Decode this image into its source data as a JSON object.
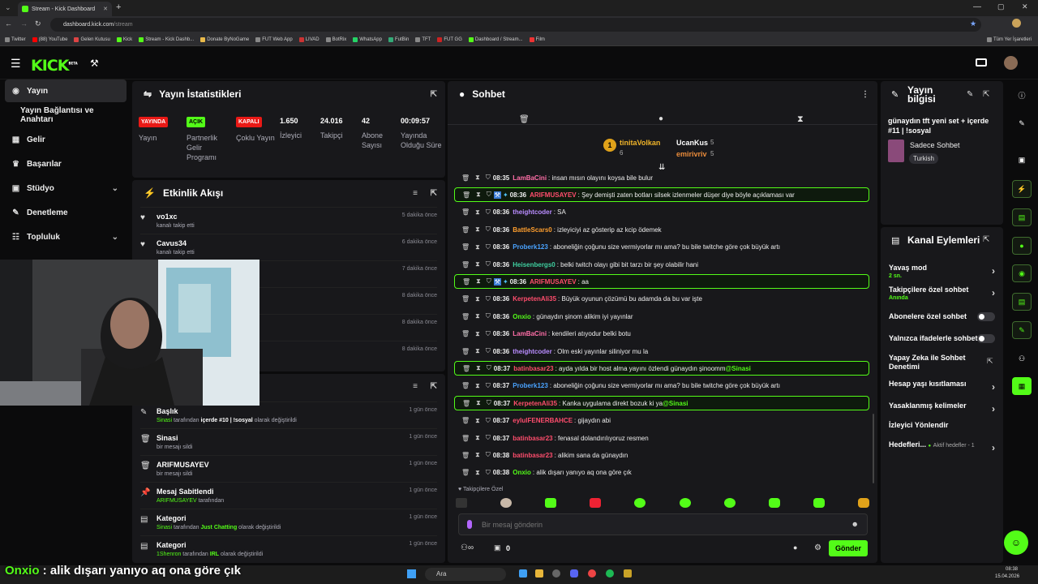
{
  "browser": {
    "tab_title": "Stream - Kick Dashboard",
    "url_host": "dashboard.kick.com",
    "url_path": "/stream",
    "bookmarks": [
      "Twitter",
      "(88) YouTube",
      "Gelen Kutusu",
      "Kick",
      "Stream - Kick Dashb...",
      "Donate ByNoGame",
      "FUT Web App",
      "LIVAD",
      "BotRix",
      "WhatsApp",
      "FutBin",
      "TFT",
      "FUT GG",
      "Dashboard / Stream...",
      "Film"
    ],
    "all_bookmarks": "Tüm Yer İşaretleri"
  },
  "brand": {
    "logo": "KICK",
    "beta": "BETA"
  },
  "sidebar": {
    "items": [
      {
        "label": "Yayın",
        "icon": "broadcast-icon"
      },
      {
        "label": "Yayın Bağlantısı ve Anahtarı",
        "icon": ""
      },
      {
        "label": "Gelir",
        "icon": "revenue-icon"
      },
      {
        "label": "Başarılar",
        "icon": "trophy-icon"
      },
      {
        "label": "Stüdyo",
        "icon": "studio-icon"
      },
      {
        "label": "Denetleme",
        "icon": "wrench-icon"
      },
      {
        "label": "Topluluk",
        "icon": "community-icon"
      }
    ]
  },
  "stats": {
    "title": "Yayın İstatistikleri",
    "items": [
      {
        "badge": "YAYINDA",
        "label": "Yayın"
      },
      {
        "badge": "AÇIK",
        "label": "Partnerlik Gelir Programı"
      },
      {
        "badge": "KAPALI",
        "label": "Çoklu Yayın"
      },
      {
        "value": "1.650",
        "label": "İzleyici"
      },
      {
        "value": "24.016",
        "label": "Takipçi"
      },
      {
        "value": "42",
        "label": "Abone Sayısı"
      },
      {
        "value": "00:09:57",
        "label": "Yayında Olduğu Süre"
      }
    ]
  },
  "activity": {
    "title": "Etkinlik Akışı",
    "items": [
      {
        "name": "vo1xc",
        "sub": "kanalı takip etti",
        "time": "5 dakika önce"
      },
      {
        "name": "Cavus34",
        "sub": "kanalı takip etti",
        "time": "6 dakika önce"
      },
      {
        "time": "7 dakika önce"
      },
      {
        "time": "8 dakika önce"
      },
      {
        "time": "8 dakika önce"
      },
      {
        "time": "8 dakika önce"
      }
    ]
  },
  "modlog": {
    "items": [
      {
        "name": "Başlık",
        "actor": "Sinasi",
        "mid": " tarafından ",
        "bold": "içerde #10 | !sosyal",
        "end": " olarak değiştirildi",
        "time": "1 gün önce"
      },
      {
        "name": "Sinasi",
        "sub": "bir mesajı sildi",
        "time": "1 gün önce"
      },
      {
        "name": "ARIFMUSAYEV",
        "sub": "bir mesajı sildi",
        "time": "1 gün önce"
      },
      {
        "name": "Mesaj Sabitlendi",
        "actor": "ARIFMUSAYEV",
        "mid": " tarafından",
        "time": "1 gün önce"
      },
      {
        "name": "Kategori",
        "actor": "Sinasi",
        "mid": " tarafından ",
        "bold": "Just Chatting",
        "end": " olarak değiştirildi",
        "time": "1 gün önce"
      },
      {
        "name": "Kategori",
        "actor": "1Shenron",
        "mid": " tarafından ",
        "bold": "IRL",
        "end": " olarak değiştirildi",
        "time": "1 gün önce"
      }
    ]
  },
  "chat": {
    "title": "Sohbet",
    "top": [
      {
        "rank": "1",
        "name": "tinitaVolkan",
        "count": "6"
      },
      {
        "name": "UcanKus",
        "count": "5"
      },
      {
        "name": "emirivriv",
        "count": "5"
      }
    ],
    "messages": [
      {
        "time": "08:35",
        "user": "LamBaCini",
        "color": "#ff6fa8",
        "text": ": insan mısın olayını koysa bile bulur"
      },
      {
        "time": "08:36",
        "user": "ARIFMUSAYEV",
        "color": "#ff4d6d",
        "text": ": Şey demişti zaten botları silsek izlenmeler düşer diye böyle açıklaması var",
        "hl": true,
        "mod": true
      },
      {
        "time": "08:36",
        "user": "theightcoder",
        "color": "#b98cff",
        "text": ": SA"
      },
      {
        "time": "08:36",
        "user": "BattleScars0",
        "color": "#ff9f2e",
        "text": ": izleyiciyi az gösterip az kcip ödemek"
      },
      {
        "time": "08:36",
        "user": "Proberk123",
        "color": "#4aa3ff",
        "text": ": aboneliğin çoğunu size vermiyorlar mı ama? bu bile twitche göre çok büyük artı"
      },
      {
        "time": "08:36",
        "user": "Heisenbergs0",
        "color": "#3fd0a0",
        "text": ": belki twitch olayı gibi bit tarzı bir şey olabilir hani"
      },
      {
        "time": "08:36",
        "user": "ARIFMUSAYEV",
        "color": "#ff4d6d",
        "text": ": aa",
        "hl": true,
        "mod": true
      },
      {
        "time": "08:36",
        "user": "KerpetenAli35",
        "color": "#ff4d6d",
        "text": ": Büyük oyunun çözümü bu adamda da bu var işte"
      },
      {
        "time": "08:36",
        "user": "Onxio",
        "color": "#53fc18",
        "text": ": günaydın şinom alikim iyi yayınlar"
      },
      {
        "time": "08:36",
        "user": "LamBaCini",
        "color": "#ff6fa8",
        "text": ": kendileri atıyodur belki botu"
      },
      {
        "time": "08:36",
        "user": "theightcoder",
        "color": "#b98cff",
        "text": ": Olm eski yayınlar siliniyor mu la"
      },
      {
        "time": "08:37",
        "user": "batinbasar23",
        "color": "#ff4d6d",
        "text": ": ayda yılda bir host alma yayını özlendi günaydın şinoomm ",
        "mention": "@Sinasi",
        "hl": true
      },
      {
        "time": "08:37",
        "user": "Proberk123",
        "color": "#4aa3ff",
        "text": ": aboneliğin çoğunu size vermiyorlar mı ama? bu bile twitche göre çok büyük artı"
      },
      {
        "time": "08:37",
        "user": "KerpetenAli35",
        "color": "#ff4d6d",
        "text": ": Kanka uygulama direkt bozuk ki ya ",
        "mention": "@Sinasi",
        "hl": true
      },
      {
        "time": "08:37",
        "user": "eylulFENERBAHCE",
        "color": "#ff4d6d",
        "text": ": gijaydın abi"
      },
      {
        "time": "08:37",
        "user": "batinbasar23",
        "color": "#ff4d6d",
        "text": ": fenasal dolandırılıyoruz resmen"
      },
      {
        "time": "08:38",
        "user": "batinbasar23",
        "color": "#ff4d6d",
        "text": ": alikim sana da günaydın"
      },
      {
        "time": "08:38",
        "user": "Onxio",
        "color": "#53fc18",
        "text": ": alik dışarı yanıyo aq ona göre çık"
      }
    ],
    "followers_only": "Takipçilere Özel",
    "placeholder": "Bir mesaj gönderin",
    "counter": "0",
    "send": "Gönder"
  },
  "stream_info": {
    "title": "Yayın bilgisi",
    "stream_title": "günaydın tft yeni set + içerde #11 | !sosyal",
    "category": "Sadece Sohbet",
    "language": "Turkish"
  },
  "channel_actions": {
    "title": "Kanal Eylemleri",
    "rows": [
      {
        "label": "Yavaş mod",
        "sub": "2 sn.",
        "type": "arrow"
      },
      {
        "label": "Takipçilere özel sohbet",
        "sub": "Anında",
        "type": "arrow"
      },
      {
        "label": "Abonelere özel sohbet",
        "type": "toggle"
      },
      {
        "label": "Yalnızca ifadelerle sohbet",
        "type": "toggle"
      },
      {
        "label": "Yapay Zeka ile Sohbet Denetimi",
        "type": "ext"
      },
      {
        "label": "Hesap yaşı kısıtlaması",
        "type": "arrow"
      },
      {
        "label": "Yasaklanmış kelimeler",
        "type": "arrow"
      },
      {
        "label": "İzleyici Yönlendir",
        "type": "none"
      },
      {
        "label": "Hedefleri...",
        "sub2": "Aktif hedefler - 1",
        "type": "arrow"
      }
    ]
  },
  "overlay": {
    "caption_user": "Onxio",
    "caption_text": " : alik dışarı yanıyo aq ona göre çık"
  },
  "taskbar": {
    "search": "Ara",
    "time": "08:38",
    "date": "15.04.2026"
  }
}
